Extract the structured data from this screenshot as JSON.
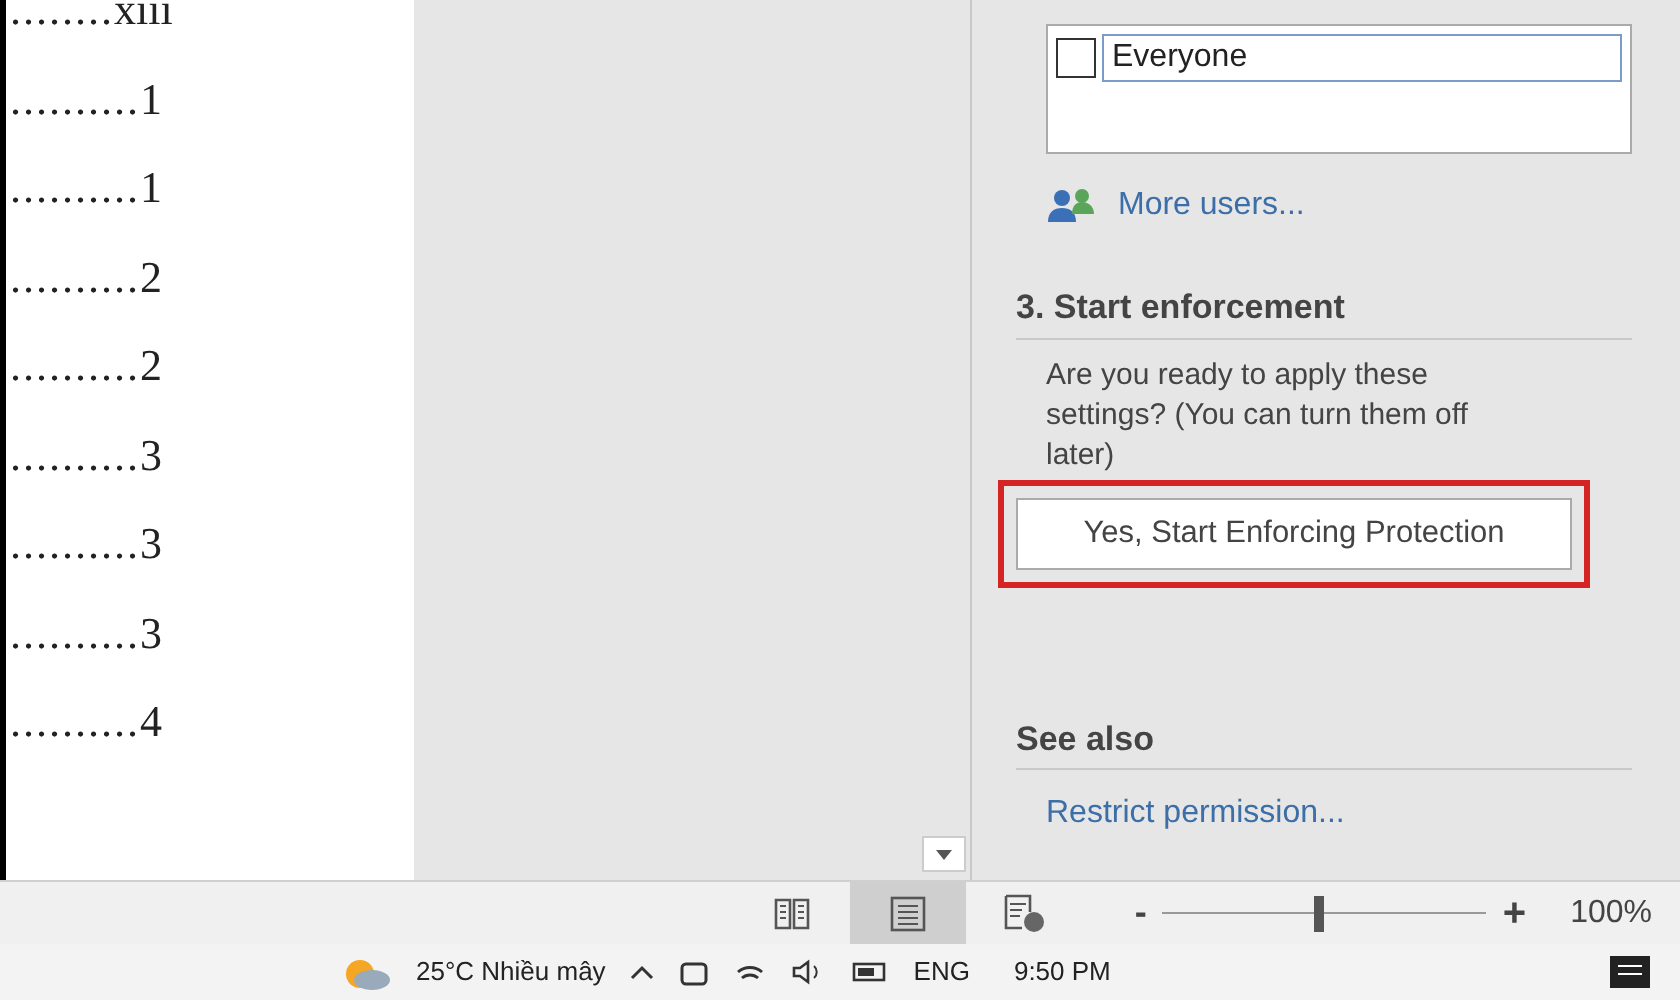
{
  "document": {
    "toc_entries": [
      {
        "leader": "........",
        "page": "xiii"
      },
      {
        "leader": "..........",
        "page": "1"
      },
      {
        "leader": "..........",
        "page": "1"
      },
      {
        "leader": "..........",
        "page": "2"
      },
      {
        "leader": "..........",
        "page": "2"
      },
      {
        "leader": "..........",
        "page": "3"
      },
      {
        "leader": "..........",
        "page": "3"
      },
      {
        "leader": "..........",
        "page": "3"
      },
      {
        "leader": "..........",
        "page": "4"
      }
    ]
  },
  "pane": {
    "groups": [
      {
        "label": "Everyone",
        "checked": false
      }
    ],
    "more_users": "More users...",
    "section_title": "3. Start enforcement",
    "description": "Are you ready to apply these settings? (You can turn them off later)",
    "button": "Yes, Start Enforcing Protection",
    "highlighted": true,
    "see_also_title": "See also",
    "links": [
      "Restrict permission..."
    ]
  },
  "status_bar": {
    "views": [
      {
        "kind": "read",
        "selected": false
      },
      {
        "kind": "print",
        "selected": true
      },
      {
        "kind": "web",
        "selected": false
      }
    ],
    "zoom_out": "-",
    "zoom_in": "+",
    "zoom": {
      "level": 0.48
    },
    "zoom_reading": "100%"
  },
  "taskbar": {
    "weather": "25°C  Nhiều mây",
    "language": "ENG",
    "time": "9:50 PM"
  }
}
